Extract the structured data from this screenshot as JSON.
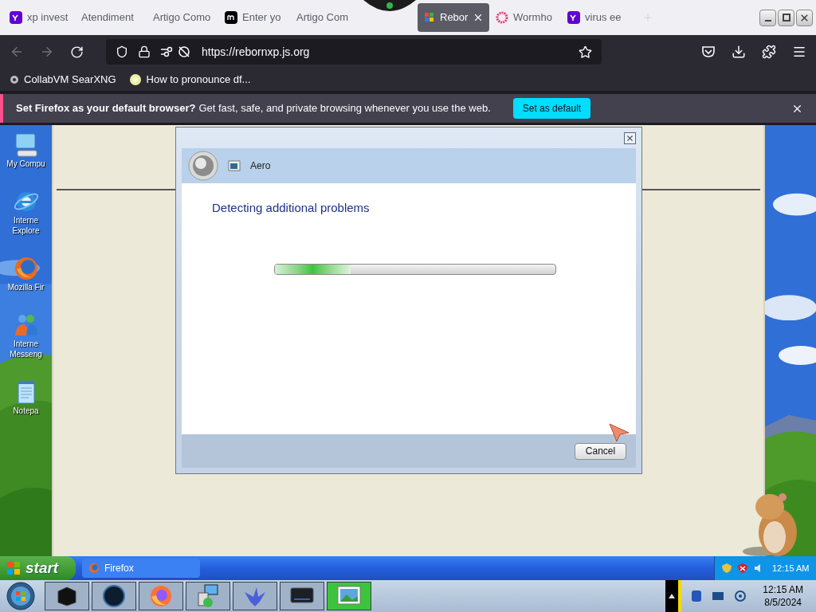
{
  "browser": {
    "tabs": [
      {
        "label": "xp invest",
        "kind": "yahoo",
        "selected": false
      },
      {
        "label": "Atendiment",
        "kind": "none",
        "selected": false
      },
      {
        "label": "Artigo Como",
        "kind": "none",
        "selected": false
      },
      {
        "label": "Enter yo",
        "kind": "medium",
        "selected": false
      },
      {
        "label": "Artigo Com",
        "kind": "none",
        "selected": false
      },
      {
        "label": "Rebor",
        "kind": "reborn",
        "selected": true
      },
      {
        "label": "Wormho",
        "kind": "wormhole",
        "selected": false
      },
      {
        "label": "virus ee",
        "kind": "yahoo",
        "selected": false
      }
    ],
    "url": "https://rebornxp.js.org",
    "bookmarks": [
      {
        "label": "CollabVM SearXNG",
        "kind": "search"
      },
      {
        "label": "How to pronounce df...",
        "kind": "dot"
      }
    ],
    "notification": {
      "title": "Set Firefox as your default browser?",
      "message": "Get fast, safe, and private browsing whenever you use the web.",
      "button": "Set as default"
    }
  },
  "desktop_icons": [
    {
      "label": "My Compu",
      "kind": "computer"
    },
    {
      "label": "Interne Explore",
      "kind": "ie"
    },
    {
      "label": "Mozilla Fir",
      "kind": "firefox"
    },
    {
      "label": "Interne Messeng",
      "kind": "messenger"
    },
    {
      "label": "Notepa",
      "kind": "notepad"
    }
  ],
  "dialog": {
    "title": "Aero",
    "heading": "Detecting additional problems",
    "progress": {
      "level": 0.27
    },
    "button": "Cancel"
  },
  "xp_taskbar": {
    "start": "start",
    "tasks": [
      {
        "label": "Firefox",
        "selected": false
      }
    ],
    "clock": "12:15 AM"
  },
  "host_taskbar": {
    "apps": [
      {
        "kind": "box"
      },
      {
        "kind": "globe"
      },
      {
        "kind": "firefox"
      },
      {
        "kind": "installer"
      },
      {
        "kind": "bird"
      },
      {
        "kind": "monitor"
      },
      {
        "kind": "viewer"
      }
    ],
    "time": "12:15 AM",
    "date": "8/5/2024"
  }
}
